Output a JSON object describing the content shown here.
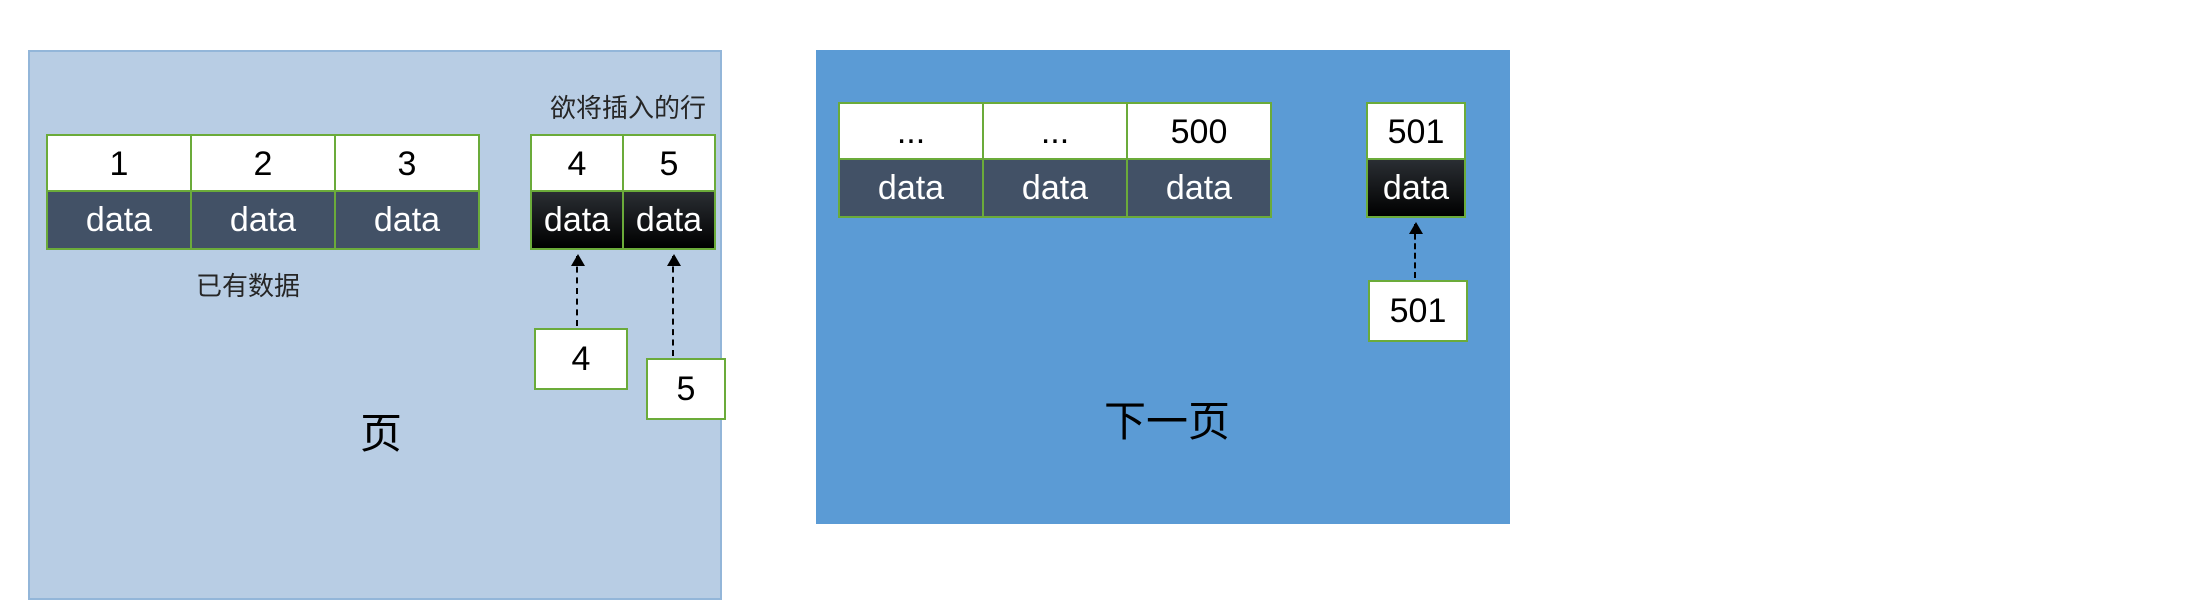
{
  "left_panel": {
    "existing_rows": [
      {
        "index": "1",
        "value": "data"
      },
      {
        "index": "2",
        "value": "data"
      },
      {
        "index": "3",
        "value": "data"
      }
    ],
    "insert_rows": [
      {
        "index": "4",
        "value": "data"
      },
      {
        "index": "5",
        "value": "data"
      }
    ],
    "insert_label": "欲将插入的行",
    "existing_label": "已有数据",
    "page_label": "页",
    "pointer_labels": [
      "4",
      "5"
    ]
  },
  "right_panel": {
    "rows": [
      {
        "index": "...",
        "value": "data"
      },
      {
        "index": "...",
        "value": "data"
      },
      {
        "index": "500",
        "value": "data"
      }
    ],
    "overflow_row": {
      "index": "501",
      "value": "data"
    },
    "pointer_label": "501",
    "page_label": "下一页"
  }
}
